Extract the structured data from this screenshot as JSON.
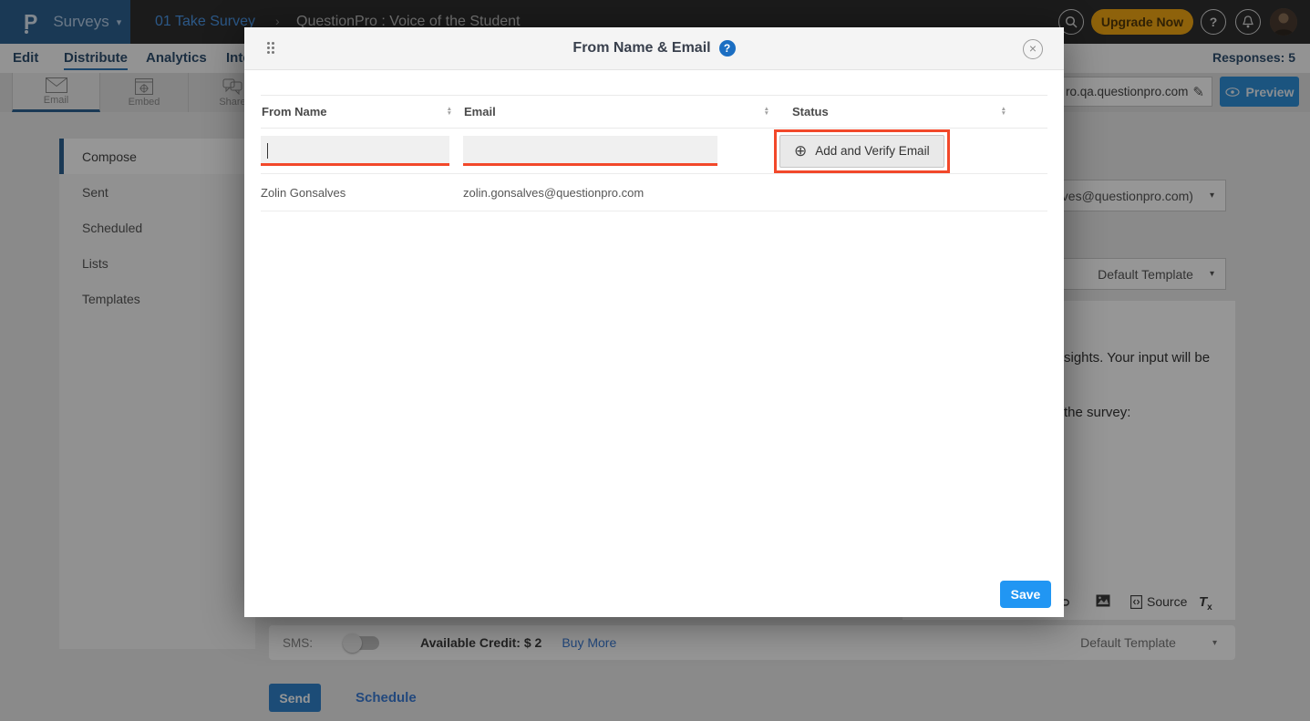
{
  "topbar": {
    "logo_glyph": "P",
    "product_label": "Surveys",
    "breadcrumb": {
      "survey_name": "01 Take Survey",
      "separator": "›",
      "survey_title": "QuestionPro : Voice of the Student"
    },
    "upgrade_label": "Upgrade Now",
    "help_glyph": "?"
  },
  "nav": {
    "items": [
      "Edit",
      "Distribute",
      "Analytics",
      "Inte"
    ],
    "active_item": "Distribute",
    "responses_label": "Responses: 5"
  },
  "toolstrip": {
    "tiles": [
      {
        "label": "Email"
      },
      {
        "label": "Embed"
      },
      {
        "label": "Share"
      }
    ],
    "url_value": "ro.qa.questionpro.com",
    "preview_label": "Preview"
  },
  "sidebar": {
    "items": [
      "Compose",
      "Sent",
      "Scheduled",
      "Lists",
      "Templates"
    ],
    "active_item": "Compose"
  },
  "compose_bg": {
    "from_select_value": "alves@questionpro.com)",
    "template_select_value": "Default Template",
    "body_line1": "sights. Your input will be",
    "body_line2": "the survey:",
    "source_label": "Source",
    "tx_label": "T",
    "tx_sub": "x",
    "sms_label": "SMS:",
    "credit_label": "Available Credit: $ 2",
    "buy_more_label": "Buy More",
    "sms_template_value": "Default Template",
    "send_label": "Send",
    "schedule_label": "Schedule"
  },
  "modal": {
    "title": "From Name & Email",
    "help_glyph": "?",
    "close_glyph": "×",
    "columns": [
      "From Name",
      "Email",
      "Status"
    ],
    "add_verify_label": "Add and Verify Email",
    "plus_glyph": "⊕",
    "rows": [
      {
        "from_name": "Zolin Gonsalves",
        "email": "zolin.gonsalves@questionpro.com"
      }
    ],
    "save_label": "Save"
  },
  "glyphs": {
    "caret_down": "▾",
    "pencil": "✎",
    "sort_up": "▲",
    "sort_down": "▼"
  },
  "colors": {
    "accent_blue": "#2196f3",
    "annotation_red": "#f2482a",
    "brand_navy": "#2d6191",
    "topbar_dark": "#2e2e2e",
    "upgrade_orange": "#f2a714",
    "link_blue": "#3a7bd5"
  }
}
